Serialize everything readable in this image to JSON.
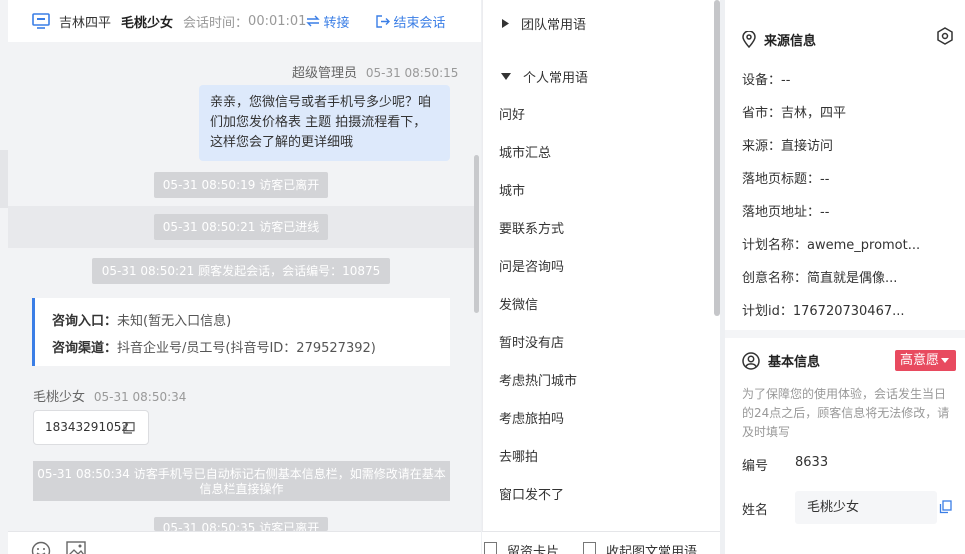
{
  "chat": {
    "header": {
      "location": "吉林四平",
      "visitor_name": "毛桃少女",
      "duration_label": "会话时间：",
      "duration_value": "00:01:01",
      "transfer_label": "转接",
      "end_label": "结束会话"
    },
    "messages": {
      "agent_name": "超级管理员",
      "agent_time": "05-31 08:50:15",
      "agent_text": "亲亲，您微信号或者手机号多少呢？咱们加您发价格表 主题 拍摄流程看下，这样您会了解的更详细哦",
      "sys_left": "05-31 08:50:19 访客已离开",
      "sys_enter": "05-31 08:50:21 访客已进线",
      "sys_start": "05-31 08:50:21 顾客发起会话，会话编号：10875",
      "entry_key": "咨询入口：",
      "entry_value": "未知(暂无入口信息)",
      "channel_key": "咨询渠道：",
      "channel_value": "抖音企业号/员工号(抖音号ID：279527392)",
      "visitor_name": "毛桃少女",
      "visitor_time": "05-31 08:50:34",
      "visitor_phone": "18343291052",
      "sys_phone_note": "05-31 08:50:34 访客手机号已自动标记右侧基本信息栏，如需修改请在基本信息栏直接操作",
      "sys_partial": "05-31 08:50:35 访客已离开"
    }
  },
  "phrases": {
    "team_group": "团队常用语",
    "personal_group": "个人常用语",
    "items": [
      "问好",
      "城市汇总",
      "城市",
      "要联系方式",
      "问是咨询吗",
      "发微信",
      "暂时没有店",
      "考虑热门城市",
      "考虑旅拍吗",
      "去哪拍",
      "窗口发不了"
    ],
    "footer_card": "留资卡片",
    "footer_collapse": "收起图文常用语"
  },
  "source_info": {
    "title": "来源信息",
    "device": "设备：--",
    "province_city": "省市：吉林，四平",
    "source": "来源：直接访问",
    "landing_title": "落地页标题：--",
    "landing_url": "落地页地址：--",
    "plan_name": "计划名称：aweme_promot...",
    "creative_name": "创意名称：简直就是偶像...",
    "plan_id": "计划id：176720730467..."
  },
  "basic_info": {
    "title": "基本信息",
    "intent_badge": "高意愿",
    "note": "为了保障您的使用体验，会话发生当日的24点之后，顾客信息将无法修改，请及时填写",
    "id_label": "编号",
    "id_value": "8633",
    "name_label": "姓名",
    "name_value": "毛桃少女"
  },
  "colors": {
    "accent": "#3a7ee6",
    "agent_bubble": "#dde9fb",
    "system_message": "#d3d4d7",
    "intent_badge": "#e84a5f"
  },
  "icons": [
    "monitor-icon",
    "transfer-icon",
    "exit-icon",
    "copy-icon",
    "emoji-icon",
    "image-icon",
    "location-pin-icon",
    "settings-hex-icon",
    "user-circle-icon",
    "caret-right-icon",
    "caret-down-icon",
    "dropdown-icon"
  ]
}
